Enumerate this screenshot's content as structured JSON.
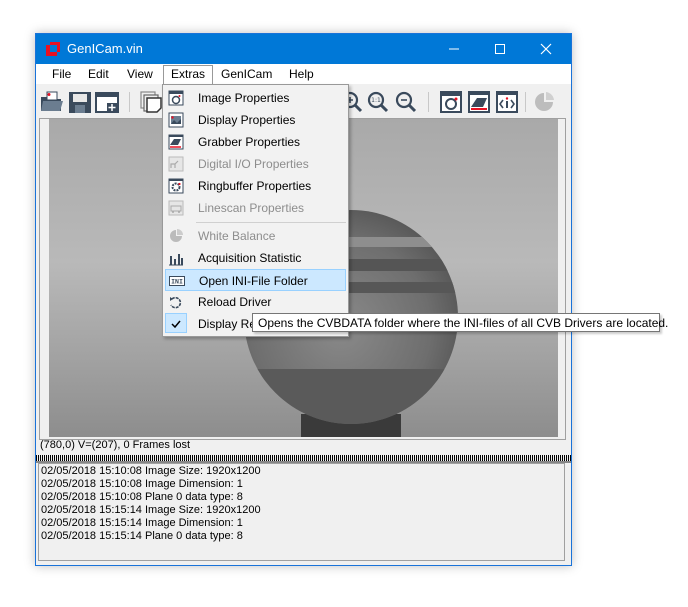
{
  "window": {
    "title": "GenICam.vin",
    "controls": [
      "minimize",
      "maximize",
      "close"
    ]
  },
  "menubar": {
    "items": [
      {
        "label": "File"
      },
      {
        "label": "Edit"
      },
      {
        "label": "View"
      },
      {
        "label": "Extras",
        "open": true
      },
      {
        "label": "GenICam"
      },
      {
        "label": "Help"
      }
    ]
  },
  "toolbar": {
    "buttons": [
      {
        "icon": "open-folder-icon"
      },
      {
        "icon": "save-icon"
      },
      {
        "icon": "new-window-icon"
      },
      {
        "icon": "copy-icon"
      },
      {
        "icon": "zoom-in-icon"
      },
      {
        "icon": "zoom-1to1-icon"
      },
      {
        "icon": "zoom-out-icon"
      },
      {
        "icon": "image-properties-icon"
      },
      {
        "icon": "grabber-properties-icon"
      },
      {
        "icon": "info-icon"
      },
      {
        "icon": "white-balance-icon",
        "disabled": true
      }
    ]
  },
  "extras_menu": {
    "items": [
      {
        "label": "Image Properties",
        "icon": "image-properties-icon",
        "enabled": true
      },
      {
        "label": "Display Properties",
        "icon": "display-properties-icon",
        "enabled": true
      },
      {
        "label": "Grabber Properties",
        "icon": "grabber-properties-icon",
        "enabled": true
      },
      {
        "label": "Digital I/O Properties",
        "icon": "digital-io-icon",
        "enabled": false
      },
      {
        "label": "Ringbuffer Properties",
        "icon": "ringbuffer-icon",
        "enabled": true
      },
      {
        "label": "Linescan Properties",
        "icon": "linescan-icon",
        "enabled": false
      },
      {
        "label": "White Balance",
        "icon": "white-balance-icon",
        "enabled": false
      },
      {
        "label": "Acquisition Statistic",
        "icon": "statistics-icon",
        "enabled": true
      },
      {
        "label": "Open INI-File Folder",
        "icon": "ini-icon",
        "enabled": true,
        "highlighted": true
      },
      {
        "label": "Reload Driver",
        "icon": "reload-icon",
        "enabled": true
      },
      {
        "label": "Display Re",
        "icon": "checkmark-icon",
        "enabled": true,
        "checked": true
      }
    ]
  },
  "tooltip": {
    "text": "Opens the CVBDATA folder where the INI-files of all CVB Drivers are located."
  },
  "status": {
    "text": "(780,0)  V=(207), 0 Frames lost"
  },
  "log": {
    "lines": [
      "02/05/2018 15:10:08 Image Size: 1920x1200",
      "02/05/2018 15:10:08 Image Dimension: 1",
      "02/05/2018 15:10:08 Plane 0 data type: 8",
      "02/05/2018 15:15:14 Image Size: 1920x1200",
      "02/05/2018 15:15:14 Image Dimension: 1",
      "02/05/2018 15:15:14 Plane 0 data type: 8"
    ]
  },
  "colors": {
    "titlebar": "#0078d7",
    "menu_highlight": "#cce8ff",
    "app_icon": "#e81123"
  }
}
